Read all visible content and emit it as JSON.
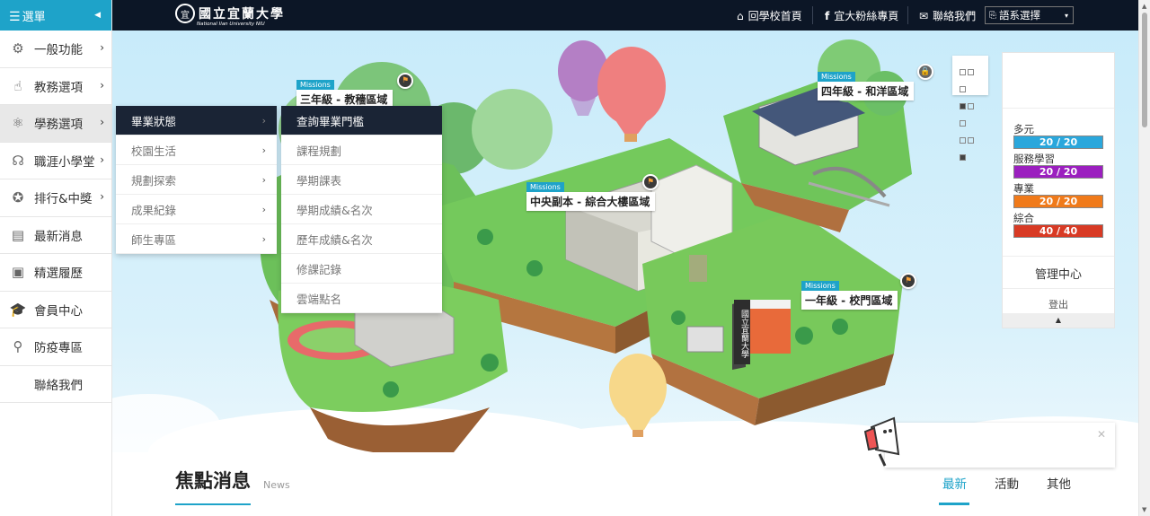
{
  "sidebar": {
    "header_label": "選單",
    "items": [
      {
        "label": "一般功能",
        "icon": "gear-icon",
        "has_arrow": true
      },
      {
        "label": "教務選項",
        "icon": "pointer-hand-icon",
        "has_arrow": true
      },
      {
        "label": "學務選項",
        "icon": "atom-icon",
        "has_arrow": true,
        "active": true
      },
      {
        "label": "職涯小學堂",
        "icon": "career-icon",
        "has_arrow": true
      },
      {
        "label": "排行&中獎",
        "icon": "star-badge-icon",
        "has_arrow": true
      },
      {
        "label": "最新消息",
        "icon": "newspaper-icon",
        "has_arrow": false
      },
      {
        "label": "精選履歷",
        "icon": "resume-icon",
        "has_arrow": false
      },
      {
        "label": "會員中心",
        "icon": "graduation-cap-icon",
        "has_arrow": false
      },
      {
        "label": "防疫專區",
        "icon": "search-icon",
        "has_arrow": false
      },
      {
        "label": "聯絡我們",
        "icon": "",
        "has_arrow": false
      }
    ]
  },
  "topbar": {
    "logo_text": "國立宜蘭大學",
    "logo_sub": "National Ilan University  NIU",
    "links": [
      {
        "label": "回學校首頁",
        "icon": "home-icon"
      },
      {
        "label": "宜大粉絲專頁",
        "icon": "facebook-icon"
      },
      {
        "label": "聯絡我們",
        "icon": "mail-icon"
      }
    ],
    "language_select": "語系選擇"
  },
  "submenu_level1": [
    {
      "label": "畢業狀態",
      "active": true
    },
    {
      "label": "校園生活",
      "active": false
    },
    {
      "label": "規劃探索",
      "active": false
    },
    {
      "label": "成果紀錄",
      "active": false
    },
    {
      "label": "師生專區",
      "active": false
    }
  ],
  "submenu_level2": [
    {
      "label": "查詢畢業門檻",
      "active": true
    },
    {
      "label": "課程規劃",
      "active": false
    },
    {
      "label": "學期課表",
      "active": false
    },
    {
      "label": "學期成績&名次",
      "active": false
    },
    {
      "label": "歷年成績&名次",
      "active": false
    },
    {
      "label": "修課記錄",
      "active": false
    },
    {
      "label": "雲端點名",
      "active": false
    }
  ],
  "map": {
    "mission_tag": "Missions",
    "zones": [
      {
        "name": "三年級 - 教穡區域",
        "locked": false
      },
      {
        "name": "四年級 - 和洋區域",
        "locked": true
      },
      {
        "name": "中央副本 - 綜合大樓區域",
        "locked": false
      },
      {
        "name": "一年級 - 校門區域",
        "locked": false
      }
    ],
    "gate_plaque": "國立宜蘭大學"
  },
  "right_panel": {
    "stats": [
      {
        "label": "多元",
        "value": "20 / 20",
        "color": "#2aa7dc"
      },
      {
        "label": "服務學習",
        "value": "20 / 20",
        "color": "#9b1fbf"
      },
      {
        "label": "專業",
        "value": "20 / 20",
        "color": "#f07a1a"
      },
      {
        "label": "綜合",
        "value": "40 / 40",
        "color": "#d83a24"
      }
    ],
    "management": "管理中心",
    "logout": "登出"
  },
  "news": {
    "title": "焦點消息",
    "subtitle": "News",
    "tabs": [
      "最新",
      "活動",
      "其他"
    ]
  }
}
